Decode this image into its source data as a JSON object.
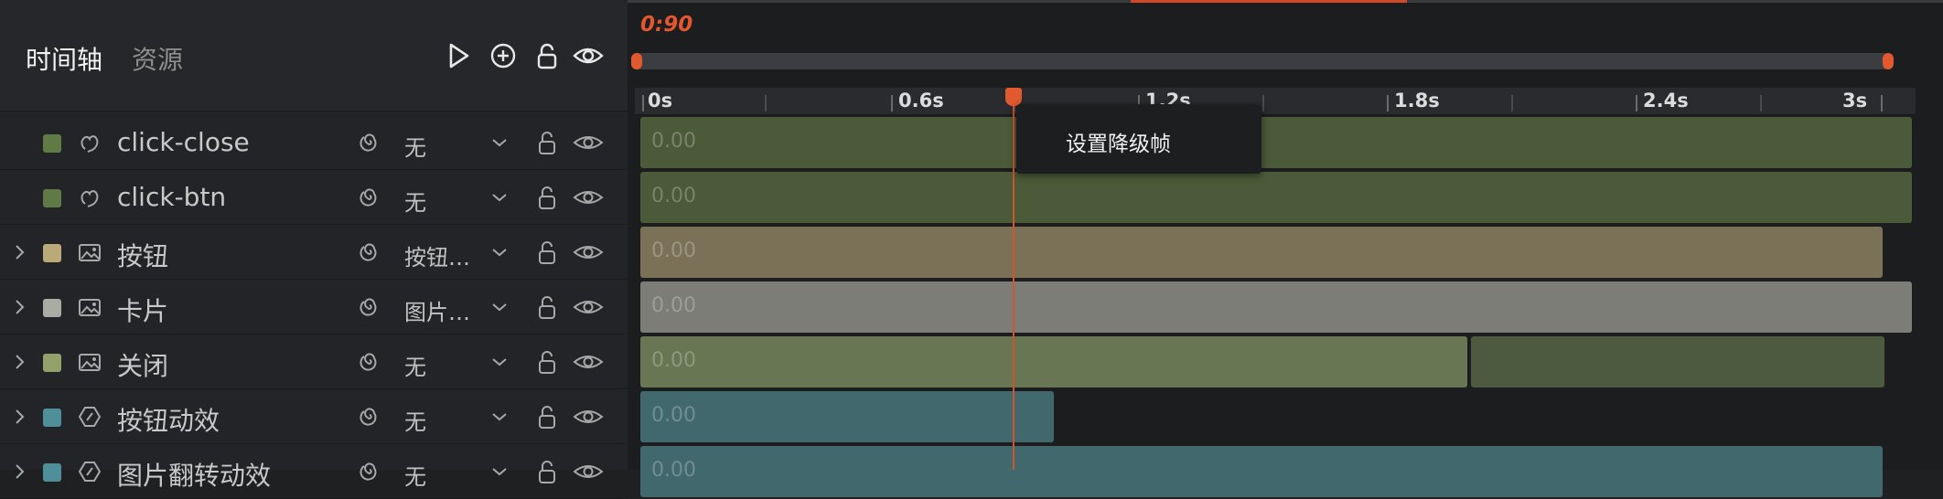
{
  "header": {
    "tab_timeline": "时间轴",
    "tab_assets": "资源"
  },
  "time_readout": "0:90",
  "ruler": {
    "labels": [
      "0s",
      "0.6s",
      "1.2s",
      "1.8s",
      "2.4s",
      "3s"
    ]
  },
  "context_menu": {
    "item": "设置降级帧"
  },
  "rows": [
    {
      "name": "click-close",
      "anim": "无",
      "swatch": "#5f7a45",
      "type": "interaction",
      "expandable": false
    },
    {
      "name": "click-btn",
      "anim": "无",
      "swatch": "#5f7a45",
      "type": "interaction",
      "expandable": false
    },
    {
      "name": "按钮",
      "anim": "按钮…",
      "swatch": "#bba978",
      "type": "image",
      "expandable": true
    },
    {
      "name": "卡片",
      "anim": "图片…",
      "swatch": "#a9aca3",
      "type": "image",
      "expandable": true
    },
    {
      "name": "关闭",
      "anim": "无",
      "swatch": "#92a06a",
      "type": "image",
      "expandable": true
    },
    {
      "name": "按钮动效",
      "anim": "无",
      "swatch": "#4e8f9a",
      "type": "effect",
      "expandable": true
    },
    {
      "name": "图片翻转动效",
      "anim": "无",
      "swatch": "#4e8f9a",
      "type": "effect",
      "expandable": true
    }
  ],
  "bar_value": "0.00",
  "colors": {
    "accent": "#e3562e",
    "bar_interaction": "#4b5a38",
    "bar_button": "#7a7156",
    "bar_card": "#7b7d76",
    "bar_close": "#687653",
    "bar_close_tail": "#4e5a40",
    "bar_effect": "#40686d"
  }
}
